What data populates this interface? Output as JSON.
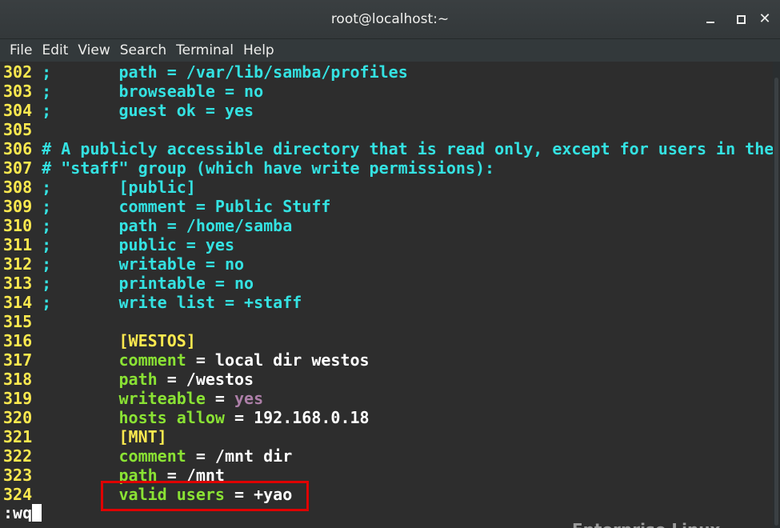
{
  "window": {
    "title": "root@localhost:~"
  },
  "menu": [
    "File",
    "Edit",
    "View",
    "Search",
    "Terminal",
    "Help"
  ],
  "lines": [
    {
      "num": "302",
      "segments": [
        {
          "text": " ;       ",
          "color": "cyan"
        },
        {
          "text": "path = /var/lib/samba/profiles",
          "color": "cyan"
        }
      ]
    },
    {
      "num": "303",
      "segments": [
        {
          "text": " ;       ",
          "color": "cyan"
        },
        {
          "text": "browseable = no",
          "color": "cyan"
        }
      ]
    },
    {
      "num": "304",
      "segments": [
        {
          "text": " ;       ",
          "color": "cyan"
        },
        {
          "text": "guest ok = yes",
          "color": "cyan"
        }
      ]
    },
    {
      "num": "305",
      "segments": []
    },
    {
      "num": "306",
      "segments": [
        {
          "text": " # A publicly accessible directory that is read only, except for users in the",
          "color": "cyan"
        }
      ]
    },
    {
      "num": "307",
      "segments": [
        {
          "text": " # \"staff\" group (which have write permissions):",
          "color": "cyan"
        }
      ]
    },
    {
      "num": "308",
      "segments": [
        {
          "text": " ;       [public]",
          "color": "cyan"
        }
      ]
    },
    {
      "num": "309",
      "segments": [
        {
          "text": " ;       comment = Public Stuff",
          "color": "cyan"
        }
      ]
    },
    {
      "num": "310",
      "segments": [
        {
          "text": " ;       path = /home/samba",
          "color": "cyan"
        }
      ]
    },
    {
      "num": "311",
      "segments": [
        {
          "text": " ;       public = yes",
          "color": "cyan"
        }
      ]
    },
    {
      "num": "312",
      "segments": [
        {
          "text": " ;       writable = no",
          "color": "cyan"
        }
      ]
    },
    {
      "num": "313",
      "segments": [
        {
          "text": " ;       printable = no",
          "color": "cyan"
        }
      ]
    },
    {
      "num": "314",
      "segments": [
        {
          "text": " ;       write list = +staff",
          "color": "cyan"
        }
      ]
    },
    {
      "num": "315",
      "segments": []
    },
    {
      "num": "316",
      "segments": [
        {
          "text": "         ",
          "color": "white"
        },
        {
          "text": "[WESTOS]",
          "color": "yellow"
        }
      ]
    },
    {
      "num": "317",
      "segments": [
        {
          "text": "         ",
          "color": "white"
        },
        {
          "text": "comment",
          "color": "green"
        },
        {
          "text": " = local dir westos",
          "color": "white"
        }
      ]
    },
    {
      "num": "318",
      "segments": [
        {
          "text": "         ",
          "color": "white"
        },
        {
          "text": "path",
          "color": "green"
        },
        {
          "text": " = /westos",
          "color": "white"
        }
      ]
    },
    {
      "num": "319",
      "segments": [
        {
          "text": "         ",
          "color": "white"
        },
        {
          "text": "writeable",
          "color": "green"
        },
        {
          "text": " = ",
          "color": "white"
        },
        {
          "text": "yes",
          "color": "purple"
        }
      ]
    },
    {
      "num": "320",
      "segments": [
        {
          "text": "         ",
          "color": "white"
        },
        {
          "text": "hosts allow",
          "color": "green"
        },
        {
          "text": " = 192.168.0.18",
          "color": "white"
        }
      ]
    },
    {
      "num": "321",
      "segments": [
        {
          "text": "         ",
          "color": "white"
        },
        {
          "text": "[MNT]",
          "color": "yellow"
        }
      ]
    },
    {
      "num": "322",
      "segments": [
        {
          "text": "         ",
          "color": "white"
        },
        {
          "text": "comment",
          "color": "green"
        },
        {
          "text": " = /mnt dir",
          "color": "white"
        }
      ]
    },
    {
      "num": "323",
      "segments": [
        {
          "text": "         ",
          "color": "white"
        },
        {
          "text": "path",
          "color": "green"
        },
        {
          "text": " = /mnt",
          "color": "white"
        }
      ]
    },
    {
      "num": "324",
      "segments": [
        {
          "text": "         ",
          "color": "white"
        },
        {
          "text": "valid users",
          "color": "green"
        },
        {
          "text": " = +yao",
          "color": "white"
        }
      ]
    }
  ],
  "command": ":wq",
  "background_text": "Enterprise Linux",
  "colors": {
    "cyan": "#34e2e2",
    "yellow": "#fce94f",
    "green": "#8ae234",
    "white": "#ffffff",
    "purple": "#ad7fa8",
    "highlight_box": "#e00000"
  }
}
